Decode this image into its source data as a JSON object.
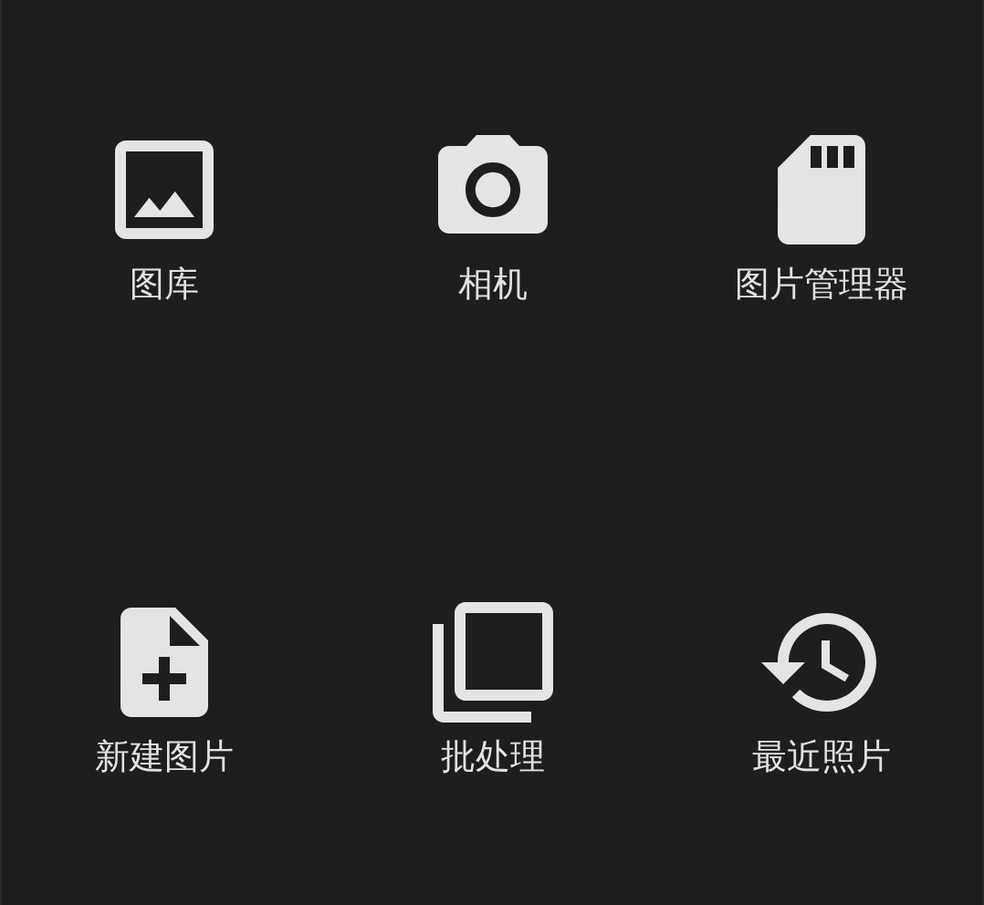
{
  "items": [
    {
      "label": "图库",
      "kind": "image"
    },
    {
      "label": "相机",
      "kind": "camera"
    },
    {
      "label": "图片管理器",
      "kind": "sdcard"
    },
    {
      "label": "新建图片",
      "kind": "newfile"
    },
    {
      "label": "批处理",
      "kind": "copies"
    },
    {
      "label": "最近照片",
      "kind": "history"
    }
  ]
}
